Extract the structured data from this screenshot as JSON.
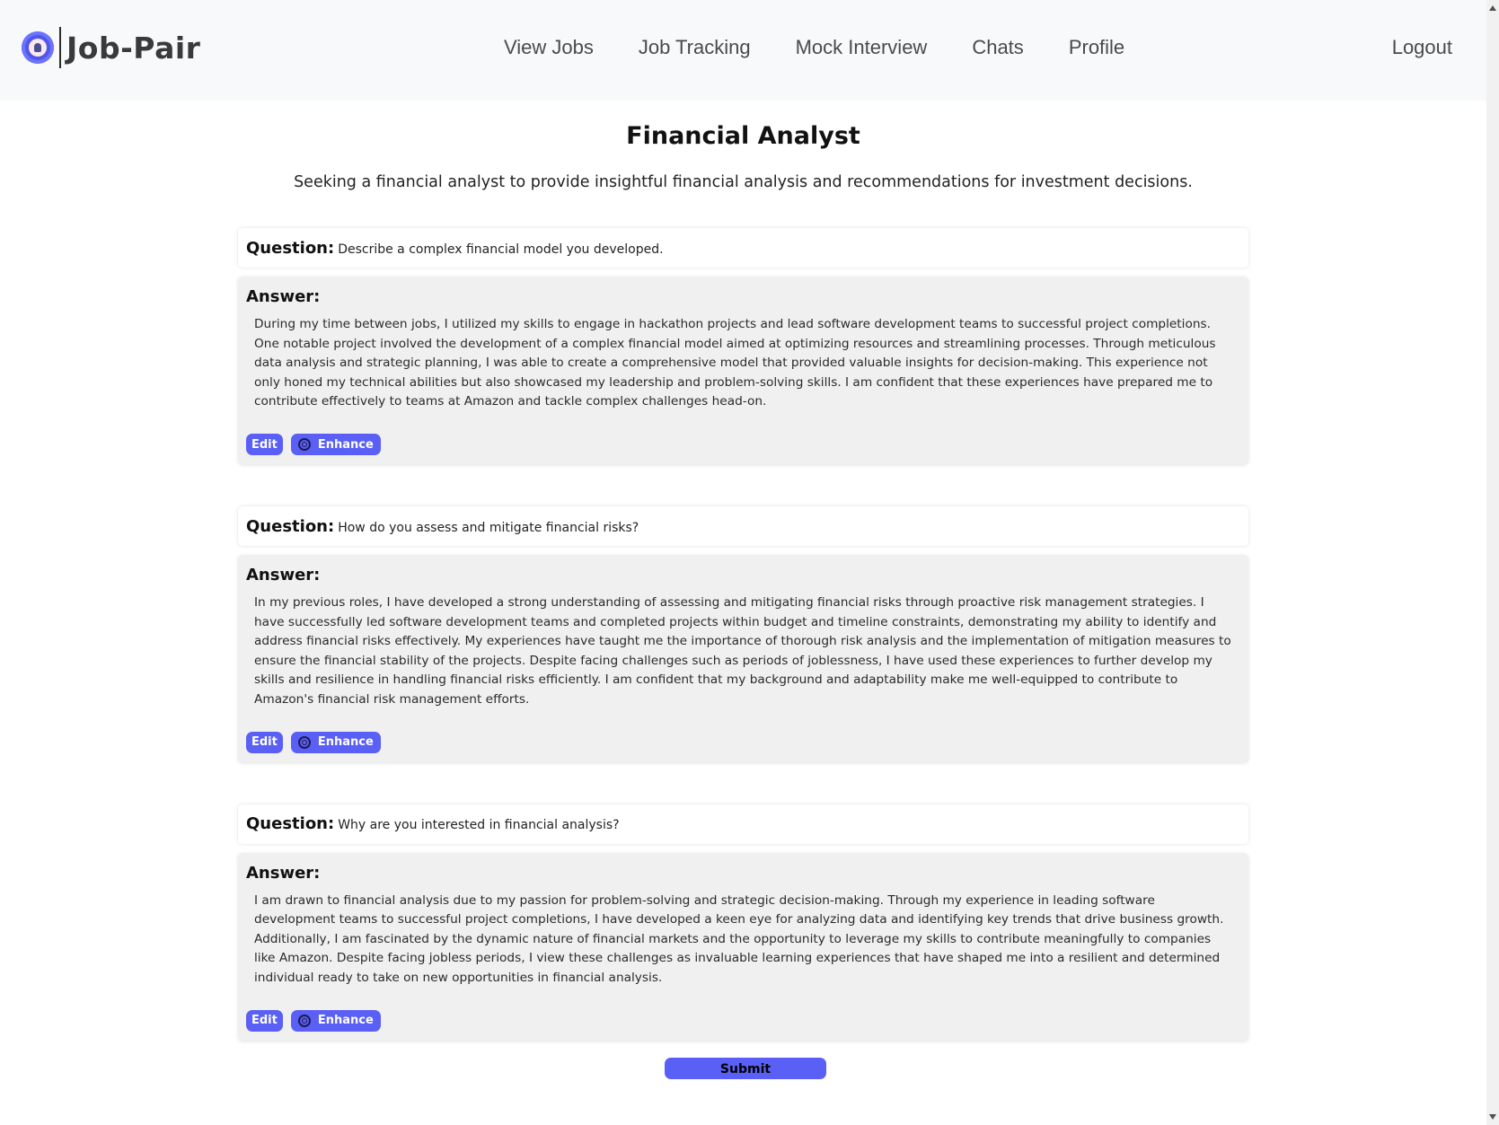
{
  "header": {
    "brand": "Job-Pair",
    "nav": [
      "View Jobs",
      "Job Tracking",
      "Mock Interview",
      "Chats",
      "Profile"
    ],
    "logout": "Logout"
  },
  "page": {
    "title": "Financial Analyst",
    "description": "Seeking a financial analyst to provide insightful financial analysis and recommendations for investment decisions."
  },
  "labels": {
    "question": "Question:",
    "answer": "Answer:",
    "edit": "Edit",
    "enhance": "Enhance",
    "submit": "Submit"
  },
  "qa": [
    {
      "question": "Describe a complex financial model you developed.",
      "answer": "During my time between jobs, I utilized my skills to engage in hackathon projects and lead software development teams to successful project completions. One notable project involved the development of a complex financial model aimed at optimizing resources and streamlining processes. Through meticulous data analysis and strategic planning, I was able to create a comprehensive model that provided valuable insights for decision-making. This experience not only honed my technical abilities but also showcased my leadership and problem-solving skills. I am confident that these experiences have prepared me to contribute effectively to teams at Amazon and tackle complex challenges head-on."
    },
    {
      "question": "How do you assess and mitigate financial risks?",
      "answer": "In my previous roles, I have developed a strong understanding of assessing and mitigating financial risks through proactive risk management strategies. I have successfully led software development teams and completed projects within budget and timeline constraints, demonstrating my ability to identify and address financial risks effectively. My experiences have taught me the importance of thorough risk analysis and the implementation of mitigation measures to ensure the financial stability of the projects. Despite facing challenges such as periods of joblessness, I have used these experiences to further develop my skills and resilience in handling financial risks efficiently. I am confident that my background and adaptability make me well-equipped to contribute to Amazon's financial risk management efforts."
    },
    {
      "question": "Why are you interested in financial analysis?",
      "answer": "I am drawn to financial analysis due to my passion for problem-solving and strategic decision-making. Through my experience in leading software development teams to successful project completions, I have developed a keen eye for analyzing data and identifying key trends that drive business growth. Additionally, I am fascinated by the dynamic nature of financial markets and the opportunity to leverage my skills to contribute meaningfully to companies like Amazon. Despite facing jobless periods, I view these challenges as invaluable learning experiences that have shaped me into a resilient and determined individual ready to take on new opportunities in financial analysis."
    }
  ],
  "colors": {
    "accent": "#5a5ff5",
    "navbar_bg": "#f8f9fa",
    "answer_bg": "#f0f0f0"
  }
}
